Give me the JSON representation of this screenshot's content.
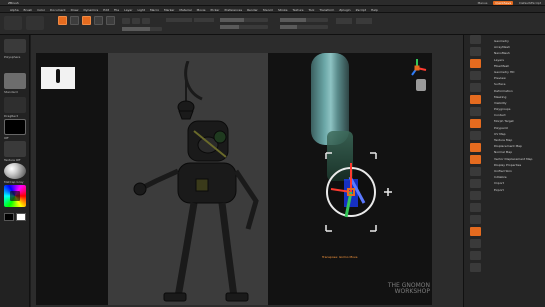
{
  "colors": {
    "accent": "#e56b1f",
    "panel": "#252525",
    "canvas": "#121212",
    "gizmo_red": "#ff3b30",
    "gizmo_green": "#34c759",
    "gizmo_blue": "#2f7cf6"
  },
  "menu": {
    "items": [
      "Alpha",
      "Brush",
      "Color",
      "Document",
      "Draw",
      "Dynamics",
      "Edit",
      "File",
      "Layer",
      "Light",
      "Macro",
      "Marker",
      "Material",
      "Movie",
      "Picker",
      "Preferences",
      "Render",
      "Stencil",
      "Stroke",
      "Texture",
      "Tool",
      "Transform",
      "Zplugin",
      "Zscript",
      "Help"
    ],
    "quicksave": "QuickSave",
    "menus": "Menus",
    "script": "DefaultZScript"
  },
  "left": {
    "tool_label": "Polysphere",
    "brush_label": "Standard",
    "stroke_label": "DragRect",
    "alpha_label": "Off",
    "texture_label": "Texture Off",
    "material_label": "MatCap Gray"
  },
  "toolbar": {
    "edit": "Edit",
    "draw": "Draw",
    "move": "Move",
    "scale": "Scale",
    "rotate": "Rotate"
  },
  "viewport": {
    "gizmo_caption": "Transpose: Gizmo Move"
  },
  "right": {
    "items": [
      "Geometry",
      "ArrayMesh",
      "NanoMesh",
      "Layers",
      "FiberMesh",
      "Geometry HD",
      "Preview",
      "Surface",
      "Deformation",
      "Masking",
      "Visibility",
      "Polygroups",
      "Contact",
      "Morph Target",
      "Polypaint",
      "UV Map",
      "Texture Map",
      "Displacement Map",
      "Normal Map",
      "Vector Displacement Map",
      "Display Properties",
      "Unified Skin",
      "Initialize",
      "Import",
      "Export"
    ]
  },
  "watermark": {
    "line1": "THE GNOMON",
    "line2": "WORKSHOP"
  }
}
